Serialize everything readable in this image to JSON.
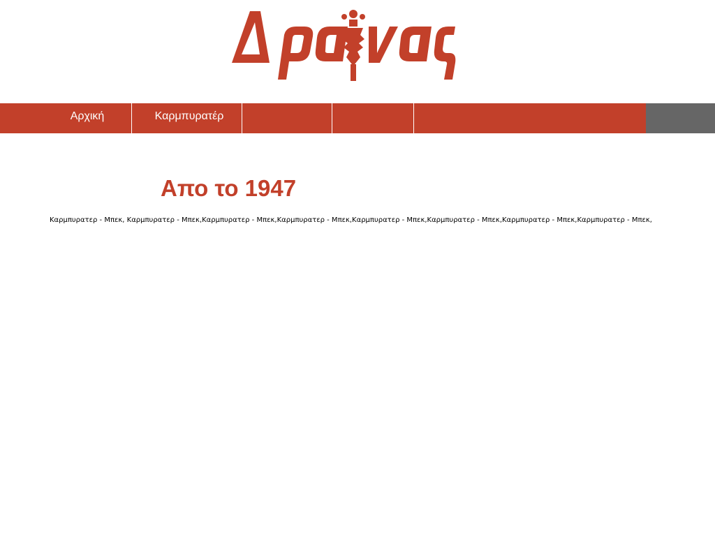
{
  "header": {
    "logo_text": "Δραΐνας",
    "brand_color": "#c2402a"
  },
  "nav": {
    "items": [
      {
        "label": "Αρχική"
      },
      {
        "label": "Καρμπυρατέρ"
      },
      {
        "label": ""
      },
      {
        "label": ""
      },
      {
        "label": ""
      }
    ],
    "bar_color": "#c2402a",
    "end_color": "#666666"
  },
  "main": {
    "heading": "Απο το 1947",
    "keywords": "Καρμπυρατερ - Μπεκ, Καρμπυρατερ - Μπεκ,Καρμπυρατερ - Μπεκ,Καρμπυρατερ - Μπεκ,Καρμπυρατερ - Μπεκ,Καρμπυρατερ - Μπεκ,Καρμπυρατερ - Μπεκ,Καρμπυρατερ - Μπεκ,"
  }
}
